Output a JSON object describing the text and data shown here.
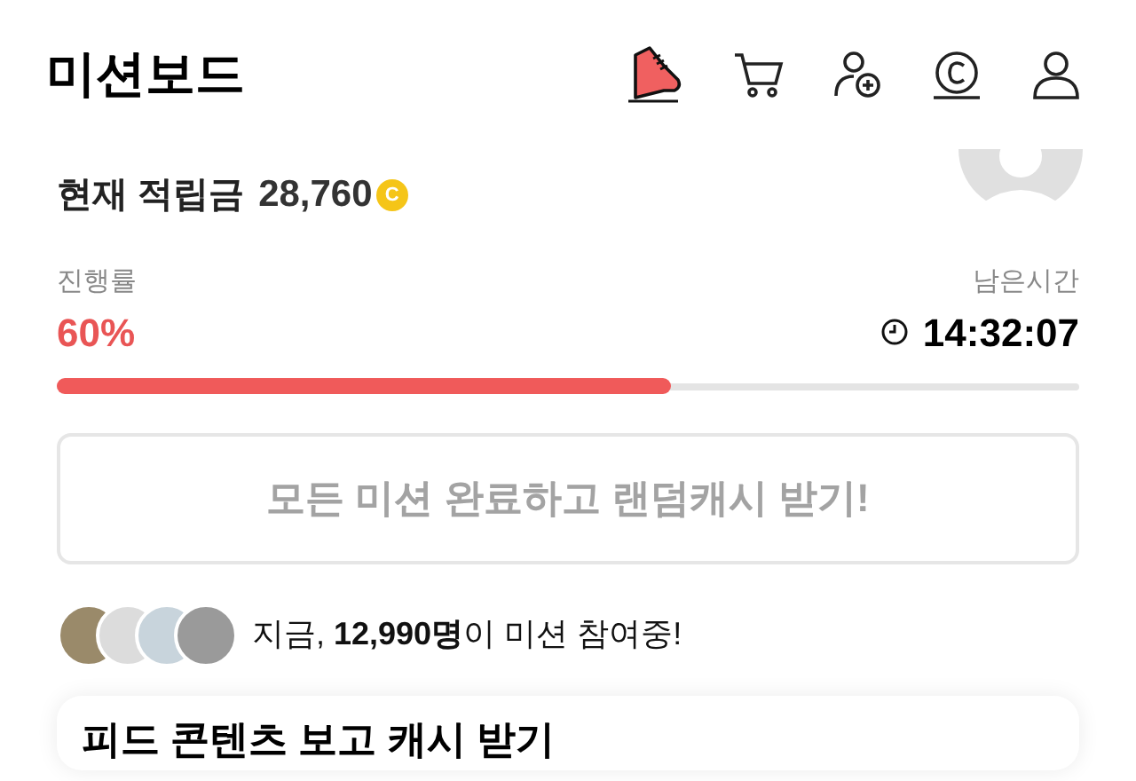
{
  "header": {
    "title": "미션보드"
  },
  "balance": {
    "label": "현재 적립금",
    "amount": "28,760",
    "coin": "C"
  },
  "progress": {
    "label": "진행률",
    "percent": "60%",
    "level": 0.6,
    "time_label": "남은시간",
    "time": "14:32:07"
  },
  "reward_button": {
    "label": "모든 미션 완료하고 랜덤캐시 받기!",
    "disabled": true
  },
  "participants": {
    "text": "지금, **12,990명**이 미션 참여중!"
  },
  "mission_card": {
    "title": "피드 콘텐츠 보고 캐시 받기"
  }
}
